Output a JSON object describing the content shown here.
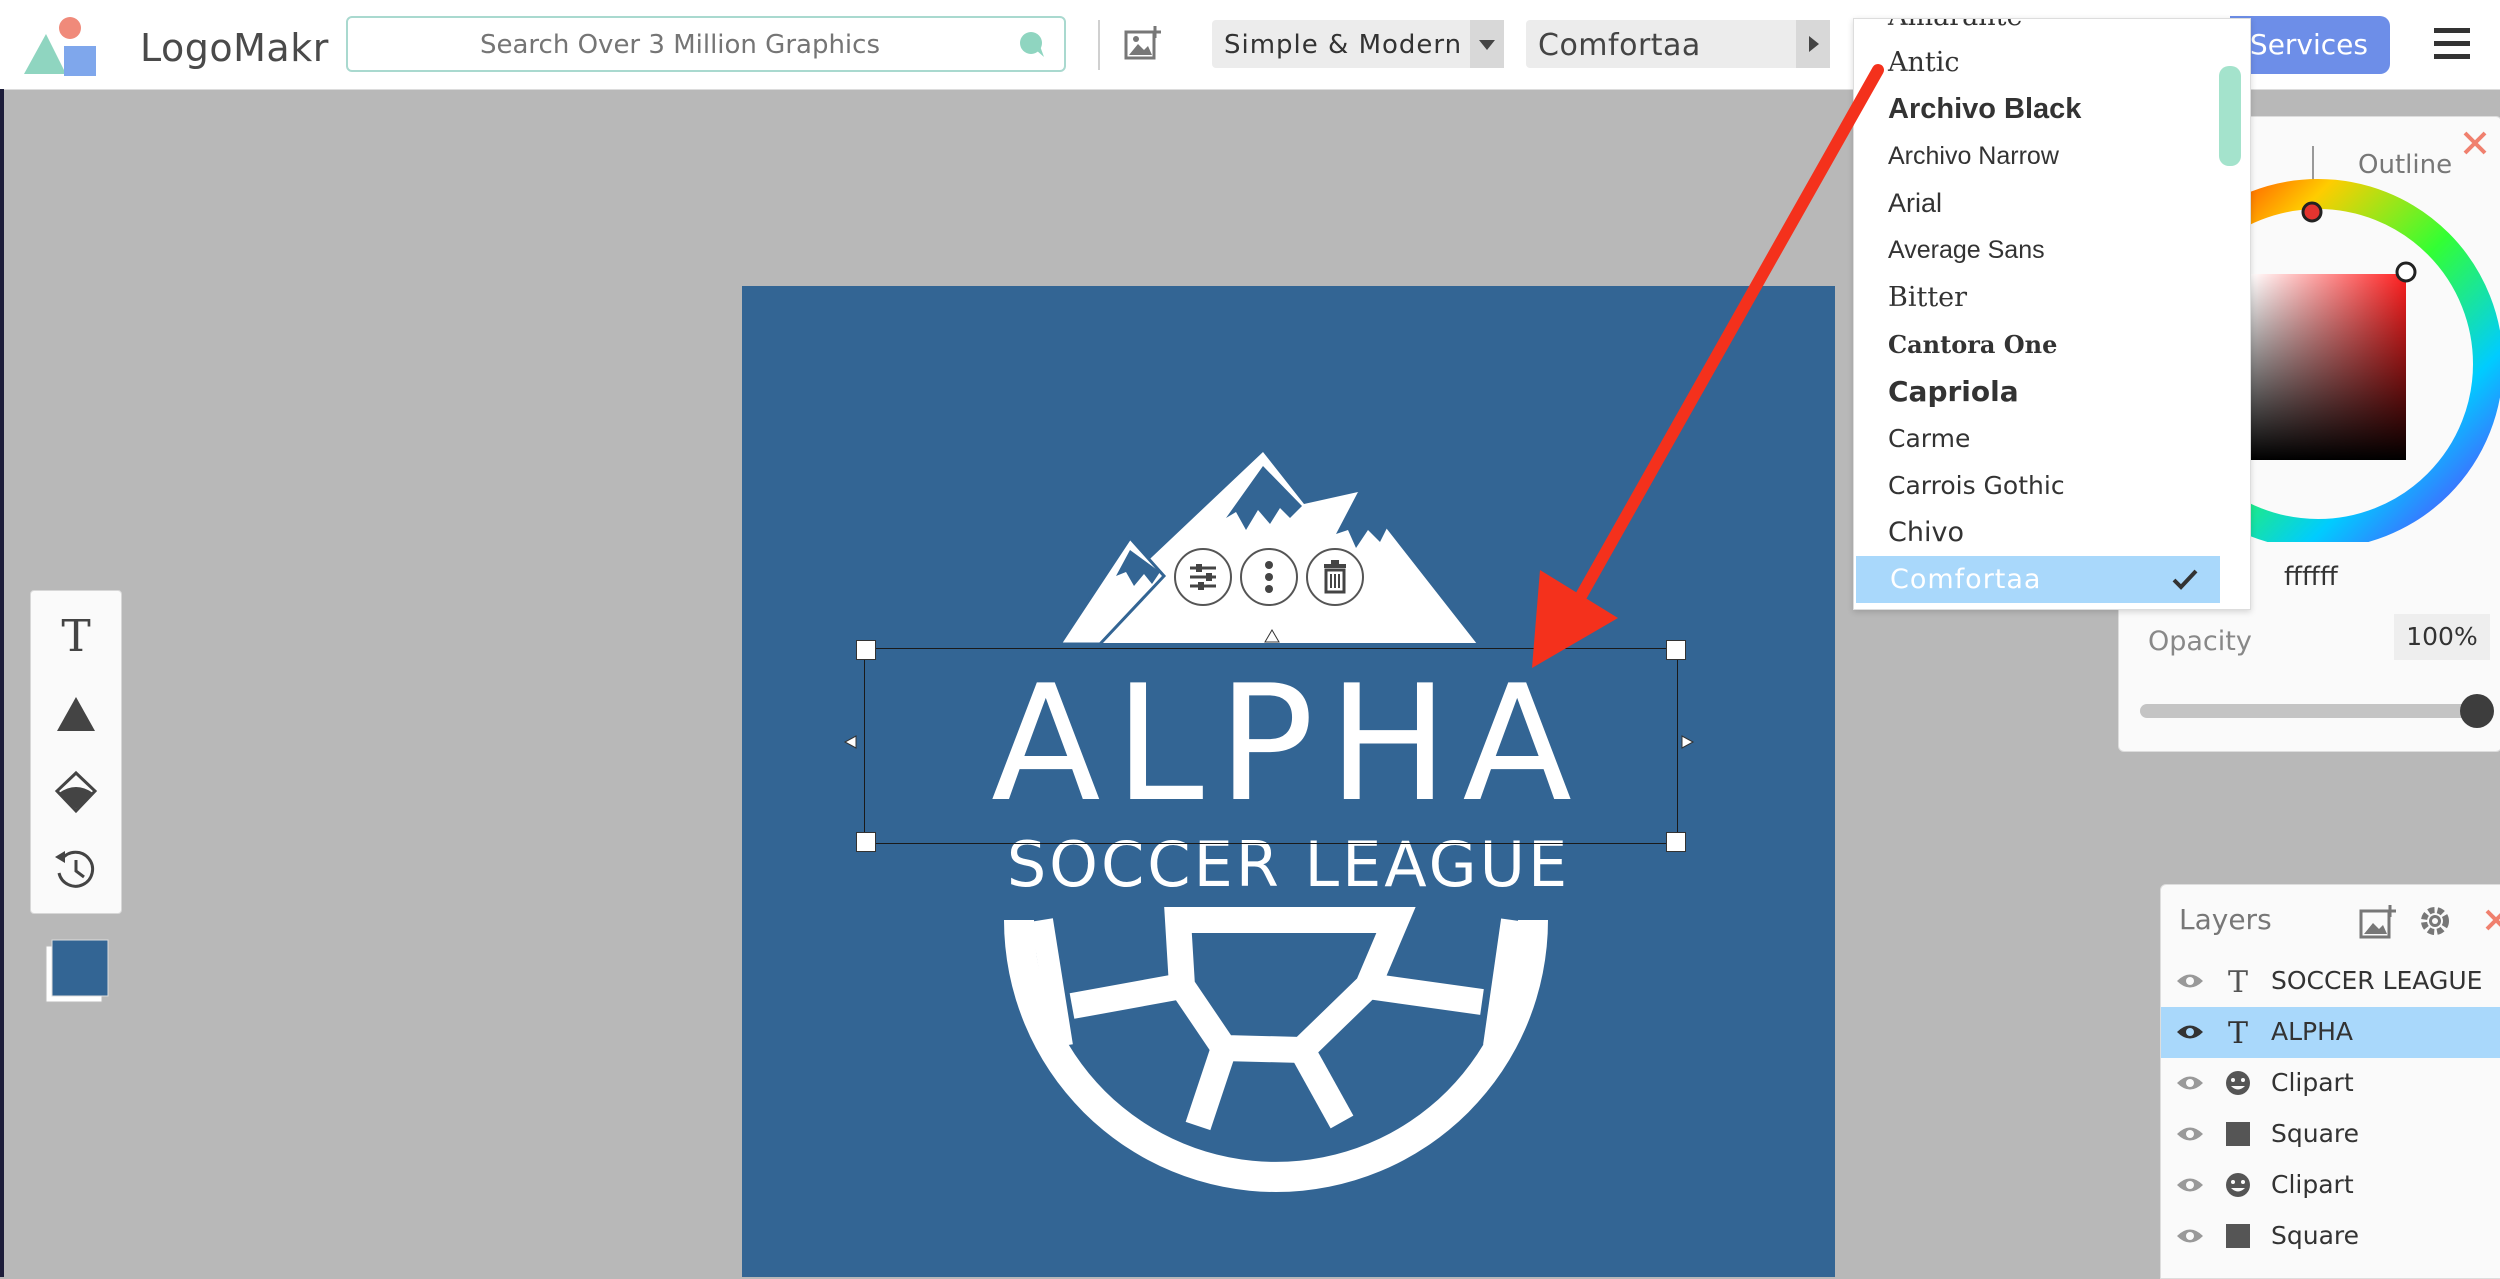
{
  "header": {
    "brand": "LogoMakr",
    "search_placeholder": "Search Over 3 Million Graphics",
    "style_dropdown": "Simple & Modern",
    "font_dropdown": "Comfortaa",
    "services_label": "Services"
  },
  "colors": {
    "canvas_bg": "#336594",
    "accent_blue": "#6d8ee8",
    "selection": "#a9d8fb",
    "annotation_arrow": "#f4311c"
  },
  "canvas": {
    "title": "ALPHA",
    "subtitle": "SOCCER LEAGUE"
  },
  "font_list": {
    "partial_top": "Amarante",
    "items": [
      "Antic",
      "Archivo Black",
      "Archivo Narrow",
      "Arial",
      "Average Sans",
      "Bitter",
      "Cantora One",
      "Capriola",
      "Carme",
      "Carrois Gothic",
      "Chivo",
      "Comfortaa"
    ],
    "selected": "Comfortaa"
  },
  "color_panel": {
    "tab_outline": "Outline",
    "hex": "ffffff",
    "opacity_label": "Opacity",
    "opacity_value": "100%"
  },
  "layers": {
    "title": "Layers",
    "items": [
      {
        "type": "text",
        "name": "SOCCER LEAGUE"
      },
      {
        "type": "text",
        "name": "ALPHA"
      },
      {
        "type": "clipart",
        "name": "Clipart"
      },
      {
        "type": "square",
        "name": "Square"
      },
      {
        "type": "clipart",
        "name": "Clipart"
      },
      {
        "type": "square",
        "name": "Square"
      }
    ],
    "active_index": 1
  },
  "icons": [
    "logo-icon",
    "search-icon",
    "add-image-icon",
    "chevron-down-icon",
    "chevron-right-icon",
    "menu-icon",
    "text-tool-icon",
    "shape-tool-icon",
    "fill-tool-icon",
    "history-icon",
    "settings-icon",
    "delete-icon",
    "more-icon",
    "check-icon",
    "eye-icon",
    "close-icon"
  ]
}
